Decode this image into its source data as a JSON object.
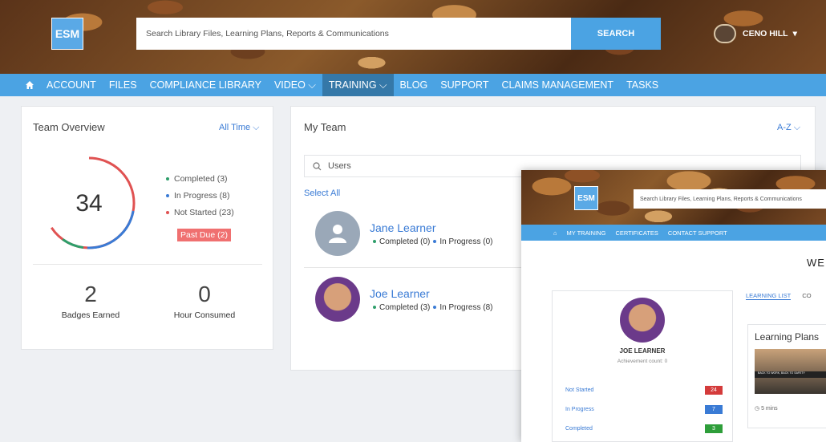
{
  "header": {
    "logo_text": "ESM",
    "search_placeholder": "Search Library Files, Learning Plans, Reports & Communications",
    "search_button": "SEARCH",
    "user_name": "CENO HILL",
    "user_caret": "▾"
  },
  "nav": {
    "home_icon": "⌂",
    "items": [
      {
        "label": "ACCOUNT"
      },
      {
        "label": "FILES"
      },
      {
        "label": "COMPLIANCE LIBRARY"
      },
      {
        "label": "VIDEO ⌵"
      },
      {
        "label": "TRAINING ⌵"
      },
      {
        "label": "BLOG"
      },
      {
        "label": "SUPPORT"
      },
      {
        "label": "CLAIMS MANAGEMENT"
      },
      {
        "label": "TASKS"
      }
    ]
  },
  "team_overview": {
    "title": "Team Overview",
    "filter": "All Time ⌵",
    "total": "34",
    "completed_label": "Completed (3)",
    "in_progress_label": "In Progress (8)",
    "not_started_label": "Not Started (23)",
    "past_due_label": "Past Due (2)",
    "badges_value": "2",
    "badges_label": "Badges Earned",
    "hours_value": "0",
    "hours_label": "Hour Consumed",
    "colors": {
      "completed": "#2e9e6a",
      "in_progress": "#3a7bd5",
      "not_started": "#e05252",
      "past_due": "#f07070"
    }
  },
  "my_team": {
    "title": "My Team",
    "sort": "A-Z ⌵",
    "search_placeholder": "Users",
    "select_all": "Select All",
    "members": [
      {
        "name": "Jane Learner",
        "completed": "Completed (0)",
        "in_progress": "In Progress (0)"
      },
      {
        "name": "Joe Learner",
        "completed": "Completed (3)",
        "in_progress": "In Progress (8)"
      }
    ]
  },
  "overlay": {
    "logo_text": "ESM",
    "search_placeholder": "Search Library Files, Learning Plans, Reports & Communications",
    "nav": [
      "MY TRAINING",
      "CERTIFICATES",
      "CONTACT SUPPORT"
    ],
    "welcome": "WE",
    "profile_name": "JOE LEARNER",
    "achievement": "Achievement count: 0",
    "rows": [
      {
        "label": "Not Started",
        "value": "24"
      },
      {
        "label": "In Progress",
        "value": "7"
      },
      {
        "label": "Completed",
        "value": "3"
      }
    ],
    "tabs": [
      "LEARNING LIST",
      "CO"
    ],
    "learning_plans_title": "Learning Plans",
    "plan_banner": "BACK TO WORK, BACK TO SAFETY",
    "duration": "5 mins"
  }
}
